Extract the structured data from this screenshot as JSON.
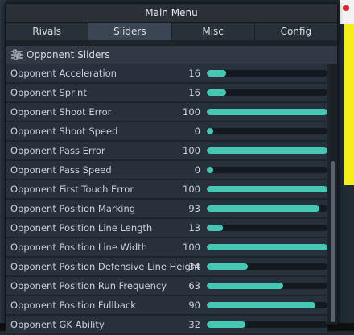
{
  "window": {
    "title": "Main Menu"
  },
  "tabs": [
    {
      "label": "Rivals"
    },
    {
      "label": "Sliders"
    },
    {
      "label": "Misc"
    },
    {
      "label": "Config"
    }
  ],
  "section": {
    "title": "Opponent Sliders",
    "icon": "sliders-icon"
  },
  "sliders": [
    {
      "label": "Opponent Acceleration",
      "value": "16",
      "fill": 0.16
    },
    {
      "label": "Opponent Sprint",
      "value": "16",
      "fill": 0.16
    },
    {
      "label": "Opponent Shoot Error",
      "value": "100",
      "fill": 1.0
    },
    {
      "label": "Opponent Shoot Speed",
      "value": "0",
      "fill": 0.0
    },
    {
      "label": "Opponent Pass Error",
      "value": "100",
      "fill": 1.0
    },
    {
      "label": "Opponent Pass Speed",
      "value": "0",
      "fill": 0.0
    },
    {
      "label": "Opponent First Touch Error",
      "value": "100",
      "fill": 1.0
    },
    {
      "label": "Opponent Position Marking",
      "value": "93",
      "fill": 0.93
    },
    {
      "label": "Opponent Position Line Length",
      "value": "13",
      "fill": 0.13
    },
    {
      "label": "Opponent Position Line Width",
      "value": "100",
      "fill": 1.0
    },
    {
      "label": "Opponent Position Defensive Line Height",
      "value": "34",
      "fill": 0.34
    },
    {
      "label": "Opponent Position Run Frequency",
      "value": "63",
      "fill": 0.63
    },
    {
      "label": "Opponent Position Fullback",
      "value": "90",
      "fill": 0.9
    },
    {
      "label": "Opponent GK Ability",
      "value": "32",
      "fill": 0.32
    }
  ],
  "colors": {
    "accent": "#45c8b3",
    "active_tab": "#3a4653",
    "row_bg": "#27313b"
  }
}
